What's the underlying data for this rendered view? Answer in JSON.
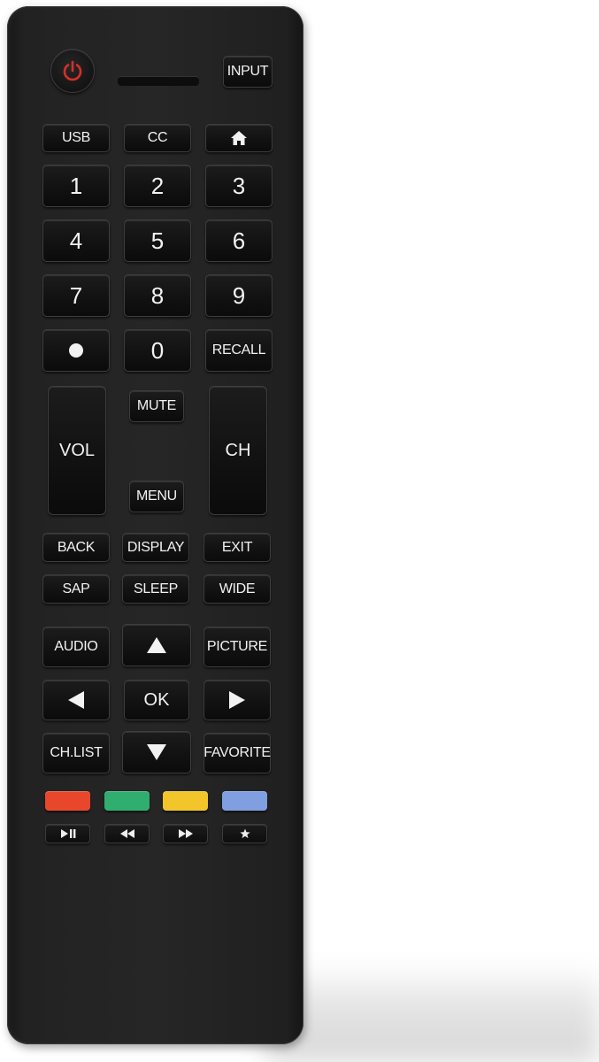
{
  "remote": {
    "top": {
      "input": "INPUT"
    },
    "row1": {
      "usb": "USB",
      "cc": "CC"
    },
    "digits": [
      "1",
      "2",
      "3",
      "4",
      "5",
      "6",
      "7",
      "8",
      "9"
    ],
    "row_last": {
      "zero": "0",
      "recall": "RECALL"
    },
    "center": {
      "vol": "VOL",
      "ch": "CH",
      "mute": "MUTE",
      "menu": "MENU"
    },
    "func1": {
      "back": "BACK",
      "display": "DISPLAY",
      "exit": "EXIT"
    },
    "func2": {
      "sap": "SAP",
      "sleep": "SLEEP",
      "wide": "WIDE"
    },
    "nav": {
      "audio": "AUDIO",
      "picture": "PICTURE",
      "ok": "OK",
      "chlist": "CH.LIST",
      "favorite": "FAVORITE"
    },
    "color_keys": {
      "red": "#e8472c",
      "green": "#2fae6f",
      "yellow": "#f2c62a",
      "blue": "#7f9fe0"
    },
    "icons": {
      "power": "power-icon",
      "home": "home-icon",
      "dot": "dot-icon",
      "up": "arrow-up-icon",
      "down": "arrow-down-icon",
      "left": "arrow-left-icon",
      "right": "arrow-right-icon",
      "play_pause": "play-pause-icon",
      "rewind": "rewind-icon",
      "fast_forward": "fast-forward-icon",
      "star": "star-icon"
    }
  }
}
